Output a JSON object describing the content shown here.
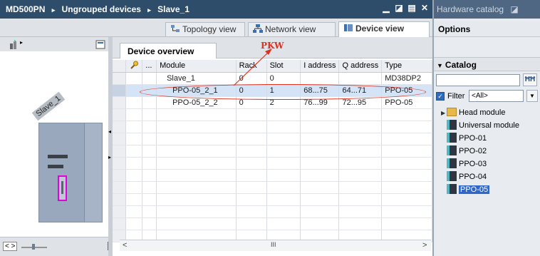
{
  "titlebar": {
    "crumbs": [
      "MD500PN",
      "Ungrouped devices",
      "Slave_1"
    ],
    "separator": "▸"
  },
  "view_tabs": {
    "topology": "Topology view",
    "network": "Network view",
    "device": "Device view"
  },
  "canvas": {
    "device_label": "Slave_1"
  },
  "overview": {
    "tab_label": "Device overview",
    "annotation": "PKW",
    "columns": [
      "",
      "...",
      "Module",
      "Rack",
      "Slot",
      "I address",
      "Q address",
      "Type"
    ],
    "rows": [
      {
        "module": "Slave_1",
        "rack": "0",
        "slot": "0",
        "iaddr": "",
        "qaddr": "",
        "type": "MD38DP2"
      },
      {
        "module": "PPO-05_2_1",
        "rack": "0",
        "slot": "1",
        "iaddr": "68...75",
        "qaddr": "64...71",
        "type": "PPO-05"
      },
      {
        "module": "PPO-05_2_2",
        "rack": "0",
        "slot": "2",
        "iaddr": "76...99",
        "qaddr": "72...95",
        "type": "PPO-05"
      }
    ],
    "selected_row": 1,
    "scroll_center_glyph": "III"
  },
  "catalog": {
    "title": "Hardware catalog",
    "options": "Options",
    "header": "Catalog",
    "search_value": "",
    "filter_label": "Filter",
    "filter_value": "<All>",
    "tree": [
      {
        "label": "Head module",
        "kind": "folder"
      },
      {
        "label": "Universal module",
        "kind": "module"
      },
      {
        "label": "PPO-01",
        "kind": "module"
      },
      {
        "label": "PPO-02",
        "kind": "module"
      },
      {
        "label": "PPO-03",
        "kind": "module"
      },
      {
        "label": "PPO-04",
        "kind": "module"
      },
      {
        "label": "PPO-05",
        "kind": "module",
        "selected": true
      }
    ]
  },
  "colors": {
    "annotation_red": "#e0301e",
    "titlebar": "#2e4d6b",
    "selection": "#d4e3f5"
  }
}
